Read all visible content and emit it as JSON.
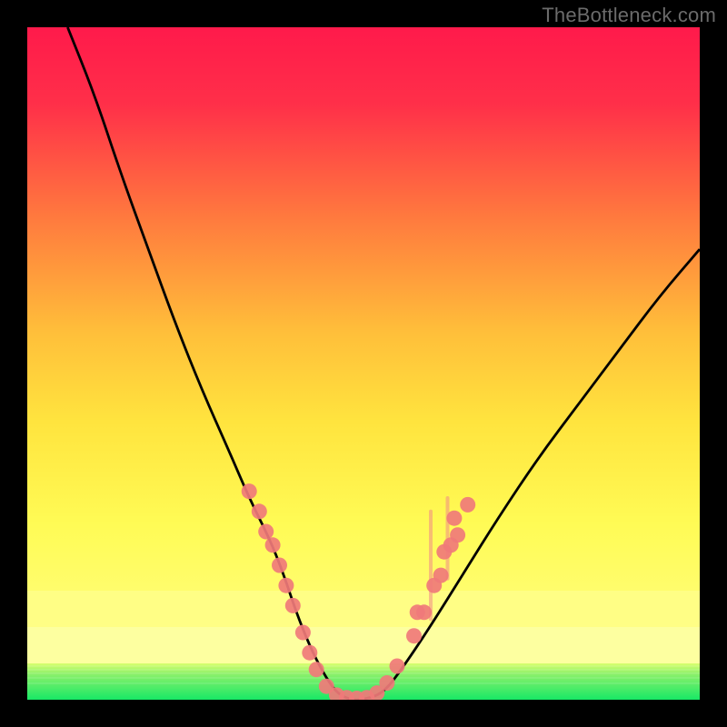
{
  "watermark": "TheBottleneck.com",
  "chart_data": {
    "type": "line",
    "title": "",
    "xlabel": "",
    "ylabel": "",
    "xlim": [
      0,
      100
    ],
    "ylim": [
      0,
      100
    ],
    "gradient_colors": {
      "top": "#ff1a4b",
      "upper_mid": "#ffd63a",
      "lower_mid": "#ffff7a",
      "bottom_band": "#ffff85",
      "green": "#27eb6c"
    },
    "series": [
      {
        "name": "curve",
        "comment": "V-shaped curve drawn over gradient; x is percent of plot width, y is percent of plot height from bottom",
        "x": [
          6,
          10,
          14,
          18,
          22,
          26,
          30,
          33,
          36,
          38,
          40,
          42,
          44,
          46,
          48,
          50,
          53,
          56,
          60,
          65,
          70,
          76,
          82,
          88,
          94,
          100
        ],
        "y": [
          100,
          90,
          78,
          67,
          56,
          46,
          37,
          30,
          24,
          19,
          13,
          8,
          4,
          1,
          0,
          0,
          1,
          5,
          11,
          19,
          27,
          36,
          44,
          52,
          60,
          67
        ]
      }
    ],
    "markers": {
      "comment": "salmon dot clusters near the bottom of the V (approx positions read off image)",
      "color": "#f07a7a",
      "points": [
        {
          "x": 33.0,
          "y": 31.0
        },
        {
          "x": 34.5,
          "y": 28.0
        },
        {
          "x": 35.5,
          "y": 25.0
        },
        {
          "x": 36.5,
          "y": 23.0
        },
        {
          "x": 37.5,
          "y": 20.0
        },
        {
          "x": 38.5,
          "y": 17.0
        },
        {
          "x": 39.5,
          "y": 14.0
        },
        {
          "x": 41.0,
          "y": 10.0
        },
        {
          "x": 42.0,
          "y": 7.0
        },
        {
          "x": 43.0,
          "y": 4.5
        },
        {
          "x": 44.5,
          "y": 2.0
        },
        {
          "x": 46.0,
          "y": 0.7
        },
        {
          "x": 47.5,
          "y": 0.3
        },
        {
          "x": 49.0,
          "y": 0.2
        },
        {
          "x": 50.5,
          "y": 0.3
        },
        {
          "x": 52.0,
          "y": 1.0
        },
        {
          "x": 53.5,
          "y": 2.5
        },
        {
          "x": 55.0,
          "y": 5.0
        },
        {
          "x": 57.5,
          "y": 9.5
        },
        {
          "x": 58.0,
          "y": 13.0
        },
        {
          "x": 59.0,
          "y": 13.0
        },
        {
          "x": 60.5,
          "y": 17.0
        },
        {
          "x": 61.5,
          "y": 18.5
        },
        {
          "x": 62.0,
          "y": 22.0
        },
        {
          "x": 63.0,
          "y": 23.0
        },
        {
          "x": 63.5,
          "y": 27.0
        },
        {
          "x": 64.0,
          "y": 24.5
        },
        {
          "x": 65.5,
          "y": 29.0
        }
      ],
      "faint_bars": [
        {
          "x": 60.0,
          "y0": 12.0,
          "y1": 28.0
        },
        {
          "x": 62.5,
          "y0": 18.0,
          "y1": 30.0
        }
      ]
    }
  }
}
